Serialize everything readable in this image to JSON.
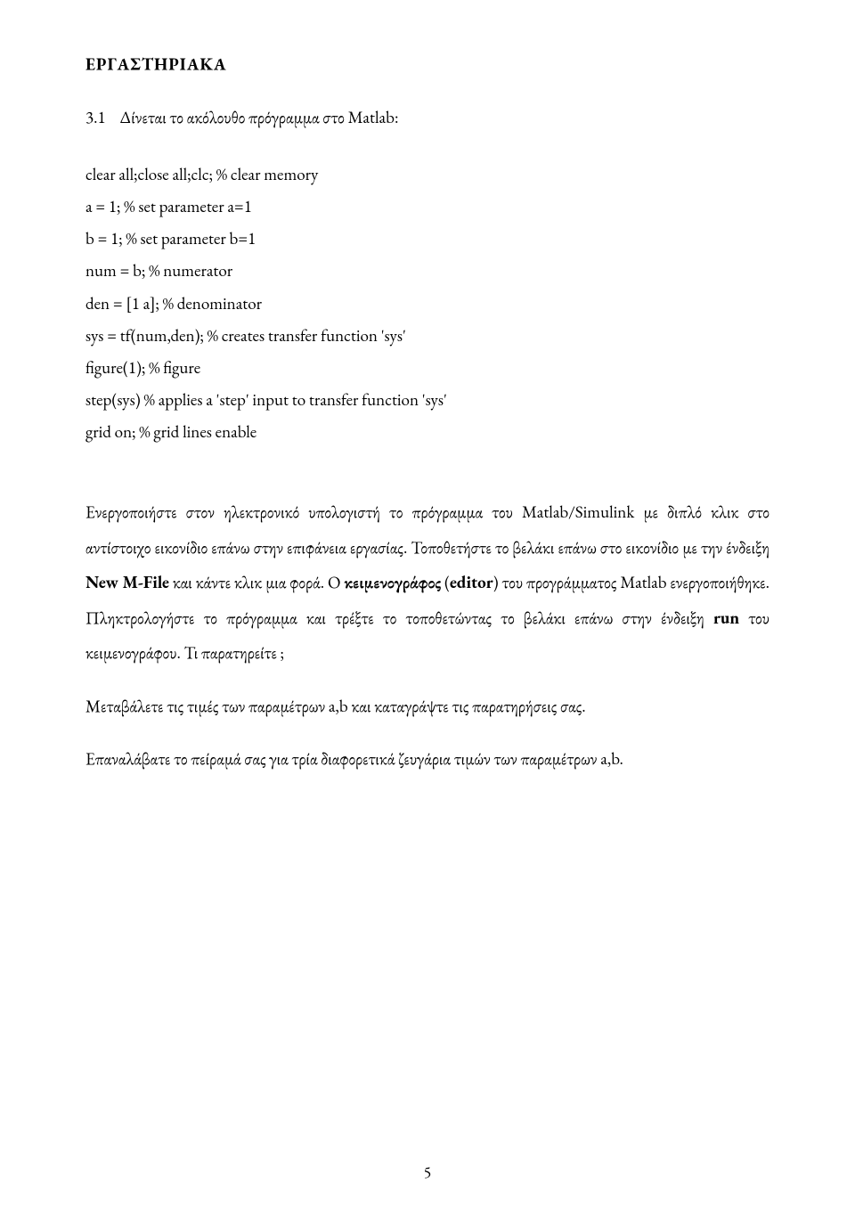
{
  "section_title": "ΕΡΓΑΣΤΗΡΙΑΚΑ",
  "item_number": "3.1",
  "prompt_text": "Δίνεται το ακόλουθο πρόγραμμα στο Matlab:",
  "code": {
    "l1": "clear all;close all;clc; % clear memory",
    "l2": "a = 1; % set parameter a=1",
    "l3": "b = 1; % set parameter b=1",
    "l4": "num = b; % numerator",
    "l5": "den = [1 a]; % denominator",
    "l6": "sys = tf(num,den); % creates transfer function 'sys'",
    "l7": "figure(1); % figure",
    "l8": "step(sys) % applies a 'step' input to transfer function 'sys'",
    "l9": "grid on; % grid lines enable"
  },
  "para1": {
    "a": "Ενεργοποιήστε στον ηλεκτρονικό υπολογιστή το πρόγραμμα του Matlab/Simulink με διπλό κλικ στο αντίστοιχο εικονίδιο επάνω στην επιφάνεια εργασίας. Τοποθετήστε το βελάκι επάνω στο εικονίδιο με την ένδειξη ",
    "b1": "New M-File",
    "c": " και κάντε κλικ μια φορά. Ο ",
    "b2": "κειμενογράφος",
    "d": " (",
    "b3": "editor",
    "e": ") του προγράμματος Matlab ενεργοποιήθηκε. Πληκτρολογήστε το πρόγραμμα και τρέξτε το τοποθετώντας το βελάκι επάνω στην ένδειξη ",
    "b4": "run",
    "f": " του κειμενογράφου. Τι παρατηρείτε ;"
  },
  "para2": "Μεταβάλετε τις τιμές των παραμέτρων a,b και καταγράψτε τις παρατηρήσεις σας.",
  "para3": "Επαναλάβατε το πείραμά σας για τρία διαφορετικά ζευγάρια τιμών των παραμέτρων a,b.",
  "page_number": "5"
}
